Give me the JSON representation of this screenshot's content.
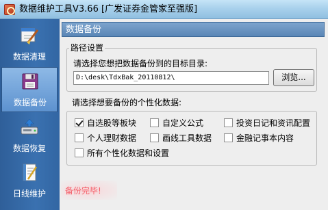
{
  "window": {
    "title": "数据维护工具V3.66 [广发证券金管家至强版]"
  },
  "sidebar": {
    "items": [
      {
        "label": "数据清理",
        "icon": "clean-icon"
      },
      {
        "label": "数据备份",
        "icon": "backup-icon",
        "active": true
      },
      {
        "label": "数据恢复",
        "icon": "restore-icon"
      },
      {
        "label": "日线维护",
        "icon": "notebook-icon"
      }
    ]
  },
  "main": {
    "header": "数据备份",
    "path_group": {
      "legend": "路径设置",
      "prompt": "请选择您想把数据备份到的目标目录:",
      "path_value": "D:\\desk\\TdxBak_20110812\\",
      "browse_label": "浏览..."
    },
    "data_prompt": "请选择想要备份的个性化数据:",
    "options": [
      {
        "label": "自选股等板块",
        "checked": true
      },
      {
        "label": "自定义公式",
        "checked": false
      },
      {
        "label": "投资日记和资讯配置",
        "checked": false
      },
      {
        "label": "个人理财数据",
        "checked": false
      },
      {
        "label": "画线工具数据",
        "checked": false
      },
      {
        "label": "金融记事本内容",
        "checked": false
      },
      {
        "label": "所有个性化数据和设置",
        "checked": false
      }
    ],
    "status": "备份完毕!"
  },
  "colors": {
    "sidebar_bg": "#3a71b0",
    "header_bg": "#5a86b6",
    "status_text": "#f2606a"
  }
}
